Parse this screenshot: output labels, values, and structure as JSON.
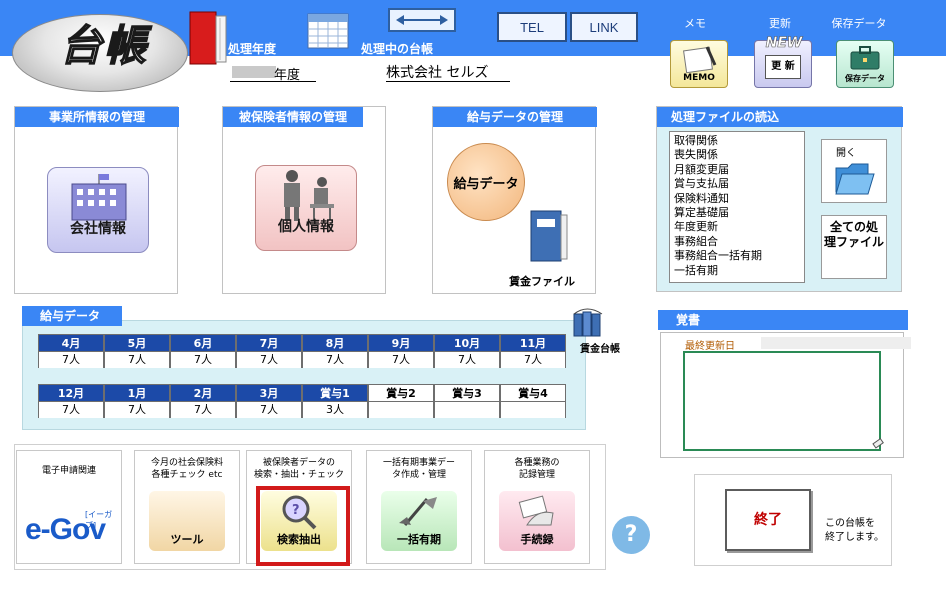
{
  "header": {
    "logo_text": "台帳",
    "fiscal_caption": "処理年度",
    "current_caption": "処理中の台帳",
    "tel_label": "TEL",
    "link_label": "LINK",
    "memo_label": "メモ",
    "memo_icon_text": "MEMO",
    "update_label": "更新",
    "update_icon_badge": "NEW",
    "update_icon_text": "更 新",
    "save_label": "保存データ",
    "save_icon_text": "保存データ",
    "fiscal_year_suffix": "年度",
    "company_name": "株式会社 セルズ"
  },
  "panels": {
    "company_title": "事業所情報の管理",
    "company_icon_label": "会社情報",
    "insured_title": "被保険者情報の管理",
    "insured_icon_label": "個人情報",
    "salary_title": "給与データの管理",
    "salary_icon_label": "給与データ",
    "wage_file_label": "賃金ファイル"
  },
  "file_reader": {
    "title": "処理ファイルの読込",
    "items": [
      "取得関係",
      "喪失関係",
      "月額変更届",
      "賞与支払届",
      "保険料通知",
      "算定基礎届",
      "年度更新",
      "事務組合",
      "事務組合一括有期",
      "一括有期"
    ],
    "open_label": "開く",
    "all_files_label": "全ての処 理ファイル"
  },
  "salary_data": {
    "title": "給与データ",
    "row1": [
      {
        "head": "4月",
        "val": "7人"
      },
      {
        "head": "5月",
        "val": "7人"
      },
      {
        "head": "6月",
        "val": "7人"
      },
      {
        "head": "7月",
        "val": "7人"
      },
      {
        "head": "8月",
        "val": "7人"
      },
      {
        "head": "9月",
        "val": "7人"
      },
      {
        "head": "10月",
        "val": "7人"
      },
      {
        "head": "11月",
        "val": "7人"
      }
    ],
    "row2": [
      {
        "head": "12月",
        "val": "7人"
      },
      {
        "head": "1月",
        "val": "7人"
      },
      {
        "head": "2月",
        "val": "7人"
      },
      {
        "head": "3月",
        "val": "7人"
      },
      {
        "head": "賞与1",
        "val": "3人"
      },
      {
        "head": "賞与2",
        "val": ""
      },
      {
        "head": "賞与3",
        "val": ""
      },
      {
        "head": "賞与4",
        "val": ""
      }
    ],
    "wage_ledger_label": "賃金台帳"
  },
  "memo": {
    "title": "覚書",
    "last_update_label": "最終更新日"
  },
  "tools": {
    "egov_caption": "電子申請関連",
    "egov_logo": "e-Gov",
    "egov_sub": "[イーガブ]",
    "tool_caption": "今月の社会保険料\n各種チェック etc",
    "tool_icon_label": "ツール",
    "search_caption": "被保険者データの\n検索・抽出・チェック",
    "search_icon_label": "検索抽出",
    "batch_caption": "一括有期事業デー\nタ作成・管理",
    "batch_icon_label": "一括有期",
    "record_caption": "各種業務の\n記録管理",
    "record_icon_label": "手続録"
  },
  "help_label": "?",
  "exit": {
    "button_label": "終了",
    "caption": "この台帳を\n終了します。"
  },
  "colors": {
    "header_blue": "#3a86f5",
    "grid_head_blue": "#1c4aa8",
    "highlight_red": "#d21a1a",
    "exit_red": "#c00000"
  }
}
